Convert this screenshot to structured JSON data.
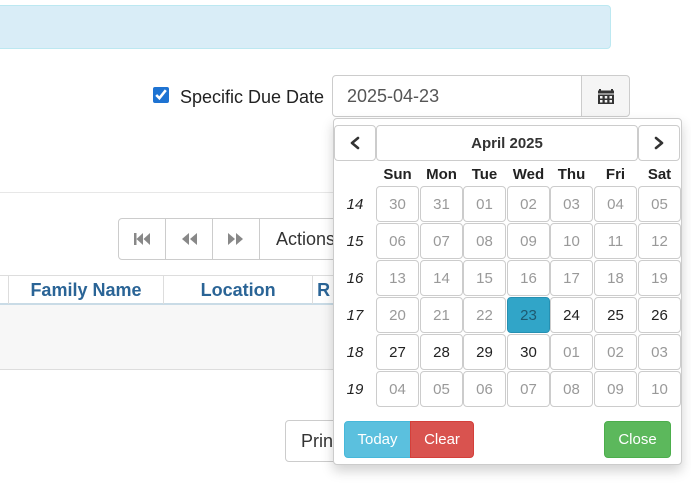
{
  "due_date": {
    "label": "Specific Due Date",
    "checked": true,
    "value": "2025-04-23",
    "calendar_icon": "calendar-icon"
  },
  "pager": {
    "icons": [
      "first-page-icon",
      "previous-page-icon",
      "next-page-icon"
    ],
    "actions_label": "Actions"
  },
  "table": {
    "columns": [
      "",
      "Family Name",
      "Location",
      "R"
    ]
  },
  "print_label": "Print",
  "datepicker": {
    "title": "April 2025",
    "prev_icon": "chevron-left-icon",
    "next_icon": "chevron-right-icon",
    "weekdays": [
      "Sun",
      "Mon",
      "Tue",
      "Wed",
      "Thu",
      "Fri",
      "Sat"
    ],
    "weeks": [
      {
        "number": "14",
        "days": [
          {
            "label": "30",
            "muted": true
          },
          {
            "label": "31",
            "muted": true
          },
          {
            "label": "01",
            "muted": true
          },
          {
            "label": "02",
            "muted": true
          },
          {
            "label": "03",
            "muted": true
          },
          {
            "label": "04",
            "muted": true
          },
          {
            "label": "05",
            "muted": true
          }
        ]
      },
      {
        "number": "15",
        "days": [
          {
            "label": "06",
            "muted": true
          },
          {
            "label": "07",
            "muted": true
          },
          {
            "label": "08",
            "muted": true
          },
          {
            "label": "09",
            "muted": true
          },
          {
            "label": "10",
            "muted": true
          },
          {
            "label": "11",
            "muted": true
          },
          {
            "label": "12",
            "muted": true
          }
        ]
      },
      {
        "number": "16",
        "days": [
          {
            "label": "13",
            "muted": true
          },
          {
            "label": "14",
            "muted": true
          },
          {
            "label": "15",
            "muted": true
          },
          {
            "label": "16",
            "muted": true
          },
          {
            "label": "17",
            "muted": true
          },
          {
            "label": "18",
            "muted": true
          },
          {
            "label": "19",
            "muted": true
          }
        ]
      },
      {
        "number": "17",
        "days": [
          {
            "label": "20",
            "muted": true
          },
          {
            "label": "21",
            "muted": true
          },
          {
            "label": "22",
            "muted": true
          },
          {
            "label": "23",
            "active": true
          },
          {
            "label": "24"
          },
          {
            "label": "25"
          },
          {
            "label": "26"
          }
        ]
      },
      {
        "number": "18",
        "days": [
          {
            "label": "27"
          },
          {
            "label": "28"
          },
          {
            "label": "29"
          },
          {
            "label": "30"
          },
          {
            "label": "01",
            "muted": true
          },
          {
            "label": "02",
            "muted": true
          },
          {
            "label": "03",
            "muted": true
          }
        ]
      },
      {
        "number": "19",
        "days": [
          {
            "label": "04",
            "muted": true
          },
          {
            "label": "05",
            "muted": true
          },
          {
            "label": "06",
            "muted": true
          },
          {
            "label": "07",
            "muted": true
          },
          {
            "label": "08",
            "muted": true
          },
          {
            "label": "09",
            "muted": true
          },
          {
            "label": "10",
            "muted": true
          }
        ]
      }
    ],
    "buttons": {
      "today": "Today",
      "clear": "Clear",
      "close": "Close"
    }
  },
  "colors": {
    "alert_bg": "#d9edf7",
    "active_day": "#31a5c8",
    "today_btn": "#5bc0de",
    "clear_btn": "#d9534f",
    "close_btn": "#5cb85c",
    "header_text": "#2a6496"
  }
}
